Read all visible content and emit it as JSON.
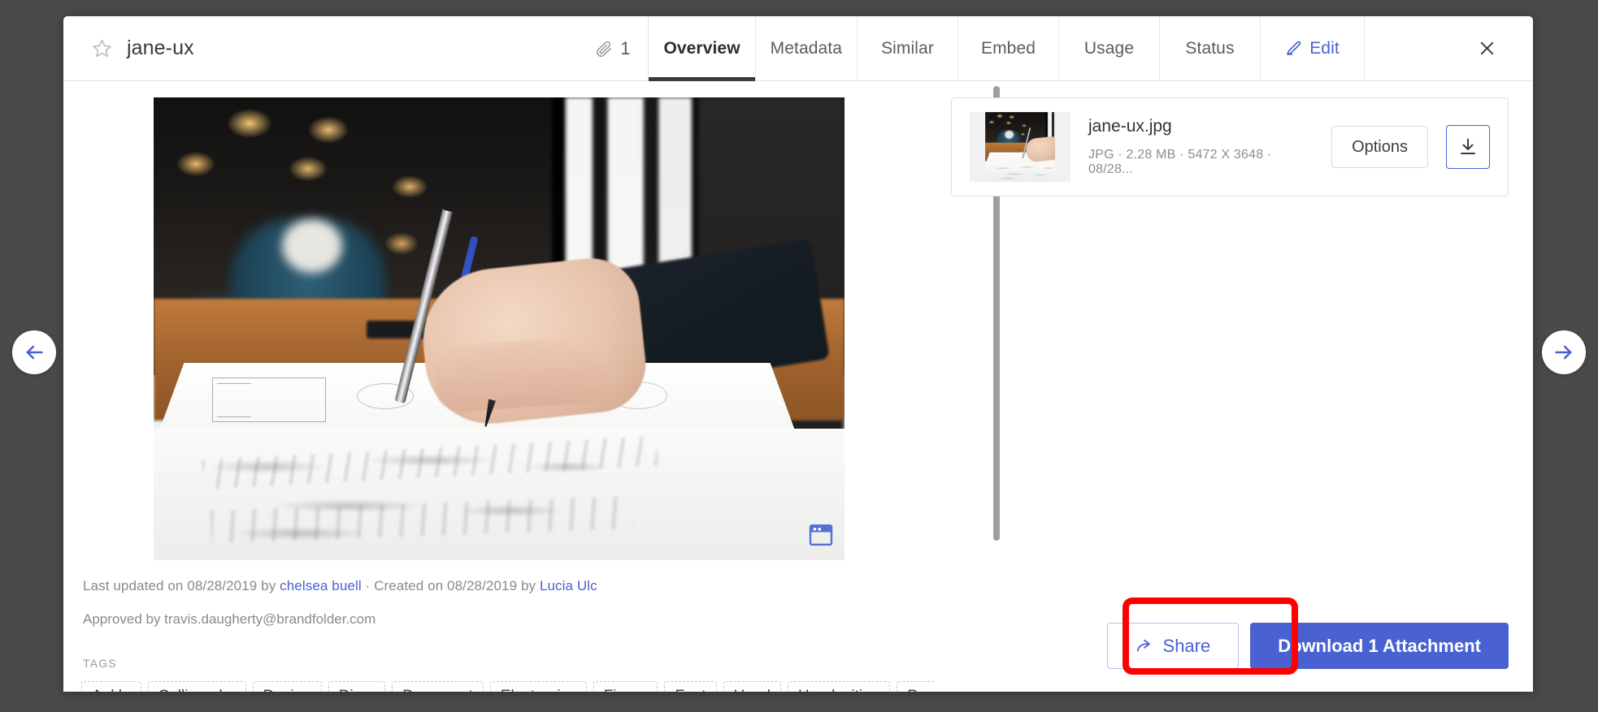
{
  "header": {
    "star_icon": "star-outline-icon",
    "title": "jane-ux",
    "attachment_icon": "paperclip-icon",
    "attachment_count": "1",
    "tabs": [
      {
        "label": "Overview",
        "active": true
      },
      {
        "label": "Metadata",
        "active": false
      },
      {
        "label": "Similar",
        "active": false
      },
      {
        "label": "Embed",
        "active": false
      },
      {
        "label": "Usage",
        "active": false
      },
      {
        "label": "Status",
        "active": false
      }
    ],
    "edit_tab": {
      "label": "Edit",
      "icon": "pencil-icon",
      "color": "#4a61d1"
    },
    "close_icon": "close-icon"
  },
  "preview": {
    "window_badge_icon": "browser-window-icon",
    "scrollbar": "vertical-scrollbar"
  },
  "meta": {
    "last_updated_prefix": "Last updated on 08/28/2019 by ",
    "last_updated_user": "chelsea buell",
    "separator": " · Created on 08/28/2019 by ",
    "created_user": "Lucia Ulc",
    "approved_by": "Approved by travis.daugherty@brandfolder.com"
  },
  "tags": {
    "label": "TAGS",
    "items": [
      "Ankle",
      "Calligraphy",
      "Design",
      "Diary",
      "Document",
      "Electronics",
      "Finger",
      "Font",
      "Hand",
      "Handwriting",
      "Paper"
    ]
  },
  "attachment": {
    "file_name": "jane-ux.jpg",
    "details": "JPG · 2.28 MB · 5472 X 3648 · 08/28...",
    "options_label": "Options",
    "download_icon": "download-arrow-icon",
    "thumbnail": "asset-thumbnail"
  },
  "footer": {
    "share_label": "Share",
    "share_icon": "share-arrow-icon",
    "download_label": "Download 1 Attachment",
    "download_color": "#4a61d1",
    "highlight_color": "#ff0000"
  },
  "navigation": {
    "prev_icon": "arrow-left-icon",
    "next_icon": "arrow-right-icon",
    "arrow_color": "#4a61d1"
  }
}
